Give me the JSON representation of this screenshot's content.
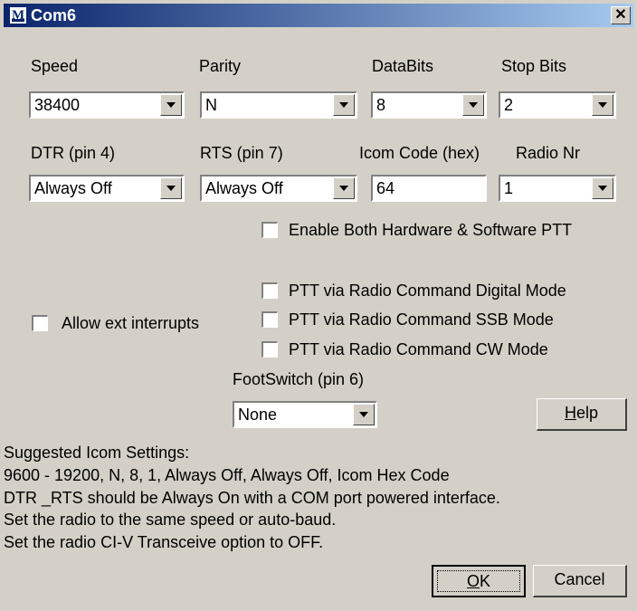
{
  "window": {
    "title": "Com6",
    "close_glyph": "✕"
  },
  "labels": {
    "speed": "Speed",
    "parity": "Parity",
    "databits": "DataBits",
    "stopbits": "Stop Bits",
    "dtr": "DTR (pin 4)",
    "rts": "RTS (pin 7)",
    "icom_code": "Icom Code (hex)",
    "radio_nr": "Radio Nr",
    "footswitch": "FootSwitch (pin 6)"
  },
  "fields": {
    "speed": "38400",
    "parity": "N",
    "databits": "8",
    "stopbits": "2",
    "dtr": "Always Off",
    "rts": "Always Off",
    "icom_code": "64",
    "radio_nr": "1",
    "footswitch": "None"
  },
  "checkboxes": {
    "enable_both_ptt": {
      "label": "Enable Both Hardware & Software PTT",
      "checked": false
    },
    "ptt_digital": {
      "label": "PTT via Radio Command Digital Mode",
      "checked": false
    },
    "ptt_ssb": {
      "label": "PTT via Radio Command SSB Mode",
      "checked": false
    },
    "ptt_cw": {
      "label": "PTT via Radio Command CW Mode",
      "checked": false
    },
    "allow_ext_interrupts": {
      "label": "Allow ext interrupts",
      "checked": false
    }
  },
  "buttons": {
    "help_ul": "H",
    "help_rest": "elp",
    "ok_ul": "O",
    "ok_rest": "K",
    "cancel": "Cancel"
  },
  "suggested": {
    "heading": "Suggested Icom Settings:",
    "line1": "9600 - 19200,  N,  8,  1,  Always Off, Always Off,  Icom Hex Code",
    "line2": "DTR _RTS should be Always On with a COM port powered interface.",
    "line3": "Set the radio to the same speed or auto-baud.",
    "line4": "Set the radio CI-V Transceive option to OFF."
  },
  "colors": {
    "face": "#d4d0c8",
    "title_start": "#0a246a",
    "title_end": "#a6caf0"
  }
}
